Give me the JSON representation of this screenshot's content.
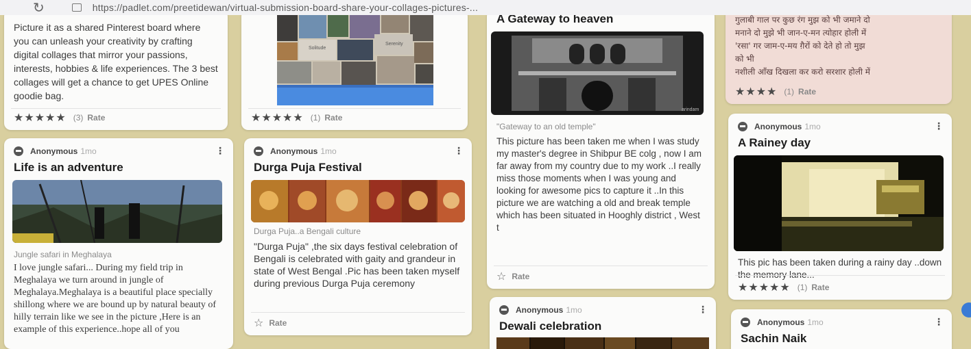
{
  "browser": {
    "url": "https://padlet.com/preetidewan/virtual-submission-board-share-your-collages-pictures-..."
  },
  "posts": {
    "intro": {
      "body": "Picture it as a shared Pinterest board where you can unleash your creativity by crafting digital collages that mirror your passions, interests, hobbies & life experiences. The 3 best collages will get a chance to get UPES Online goodie bag.",
      "count": "(3)",
      "rate": "Rate"
    },
    "collage": {
      "count": "(1)",
      "rate": "Rate",
      "tile1": "Solitude",
      "tile2": "Serenity"
    },
    "gateway": {
      "title": "A Gateway to heaven",
      "caption": "\"Gateway to an old temple\"",
      "body": "This picture has been taken me when I was study my master's degree in Shibpur BE colg , now I am far away from my country due to my work ..I really miss those moments when I was young and looking for awesome pics to capture it ..In this picture we are watching a old and break temple which has been situated in Hooghly district , West t",
      "rate": "Rate",
      "watermark": "arindam"
    },
    "hindi": {
      "lines": [
        "गुलाबी गाल पर कुछ रंग मुझ को भी जमाने दो",
        "मनाने दो मुझे भी जान-ए-मन त्योहार होली में",
        "'रसा' गर जाम-ए-मय ग़ैरों को देते हो तो मुझ",
        "को भी",
        "नशीली आँख दिखला कर करो सरशार होली में"
      ],
      "count": "(1)",
      "rate": "Rate"
    },
    "jungle": {
      "author": "Anonymous",
      "time": "1mo",
      "title": "Life is an adventure",
      "caption": "Jungle safari in Meghalaya",
      "body": "I love jungle safari... During my field trip in Meghalaya we turn around in jungle of Meghalaya.Meghalaya is a beautiful place specially shillong where we are bound up by natural beauty of hilly terrain like we see in the picture ,Here is an example of this experience..hope all of you"
    },
    "durga": {
      "author": "Anonymous",
      "time": "1mo",
      "title": "Durga Puja Festival",
      "caption": "Durga Puja..a Bengali culture",
      "body": "\"Durga Puja\" ,the six days festival celebration of Bengali is celebrated with gaity and grandeur in state of West Bengal .Pic has been taken myself during previous Durga Puja ceremony",
      "rate": "Rate"
    },
    "rainy": {
      "author": "Anonymous",
      "time": "1mo",
      "title": "A Rainey day",
      "body": "This pic has been taken during a rainy day ..down the memory lane...",
      "count": "(1)",
      "rate": "Rate"
    },
    "dewali": {
      "author": "Anonymous",
      "time": "1mo",
      "title": "Dewali celebration"
    },
    "sachin": {
      "author": "Anonymous",
      "time": "1mo",
      "title": "Sachin Naik"
    }
  },
  "icons": {
    "star": "star-icon",
    "star_outline": "star-outline-icon",
    "more": "more-icon",
    "avatar": "avatar-icon",
    "reload": "reload-icon"
  }
}
